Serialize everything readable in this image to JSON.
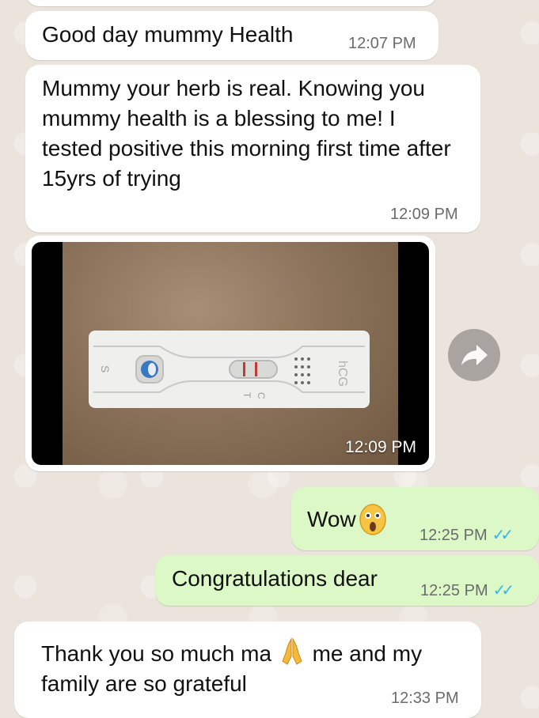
{
  "messages": [
    {
      "text": "Good day mummy Health",
      "time": "12:07 PM"
    },
    {
      "text": "Mummy your herb is real. Knowing you mummy health is a blessing to me! I tested positive this morning first time after 15yrs of trying",
      "time": "12:09 PM"
    },
    {
      "type": "image",
      "time": "12:09 PM",
      "strip_text": {
        "s": "S",
        "c": "C",
        "t": "T",
        "brand": "hCG"
      }
    },
    {
      "text": "Wow",
      "emoji": "astonished-face",
      "time": "12:25 PM",
      "status": "read"
    },
    {
      "text": "Congratulations dear",
      "time": "12:25 PM",
      "status": "read"
    },
    {
      "text_before": "Thank you so much ma",
      "emoji": "folded-hands",
      "text_after": " me and my family are so grateful",
      "time": "12:33 PM"
    }
  ],
  "colors": {
    "incoming": "#ffffff",
    "outgoing": "#dcf8c6",
    "read_ticks": "#34b7f1",
    "wallpaper": "#ebe4dd"
  }
}
